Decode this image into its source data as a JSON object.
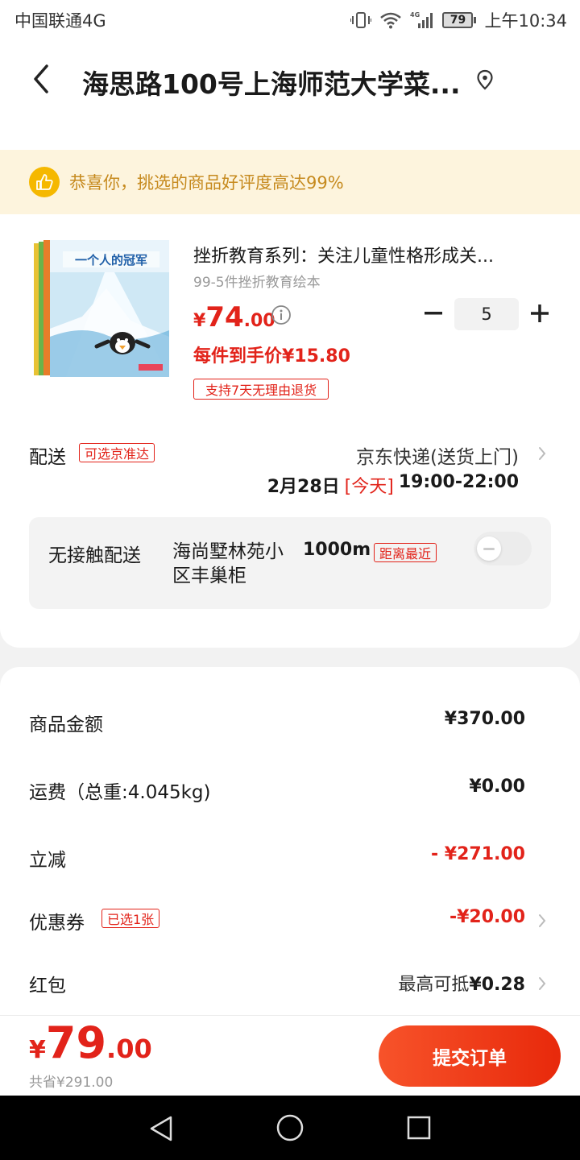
{
  "status_bar": {
    "carrier": "中国联通4G",
    "battery": "79",
    "time": "上午10:34",
    "network_label": "4G"
  },
  "header": {
    "address": "海思路100号上海师范大学菜..."
  },
  "banner": {
    "text": "恭喜你，挑选的商品好评度高达99%"
  },
  "product": {
    "title": "挫折教育系列：关注儿童性格形成关...",
    "subtitle": "99-5件挫折教育绘本",
    "price_currency": "¥",
    "price_int": "74",
    "price_dec": ".00",
    "quantity": "5",
    "unit_price": "每件到手价¥15.80",
    "return_policy": "支持7天无理由退货",
    "cover_title": "一个人的冠军"
  },
  "shipping": {
    "label": "配送",
    "tag": "可选京准达",
    "method": "京东快递(送货上门)",
    "date": "2月28日",
    "today": "[今天]",
    "window": "19:00-22:00"
  },
  "contactless": {
    "label": "无接触配送",
    "place": "海尚墅林苑小区丰巢柜",
    "distance": "1000m",
    "tag": "距离最近",
    "enabled": false
  },
  "summary": {
    "rows": [
      {
        "label": "商品金额",
        "value": "¥370.00"
      },
      {
        "label": "运费（总重:4.045kg)",
        "value": "¥0.00"
      },
      {
        "label": "立减",
        "value": "- ¥271.00"
      },
      {
        "label": "优惠券",
        "tag": "已选1张",
        "value": "-¥20.00"
      },
      {
        "label": "红包",
        "value_prefix": "最高可抵",
        "value": "¥0.28"
      }
    ]
  },
  "footer": {
    "total_currency": "¥",
    "total_int": "79",
    "total_dec": ".00",
    "saved": "共省¥291.00",
    "submit_label": "提交订单"
  },
  "colors": {
    "accent_red": "#e2231a",
    "banner_bg": "#fdf4dd",
    "banner_text": "#c68a1e",
    "submit_gradient_start": "#f7532a",
    "submit_gradient_end": "#e8290b"
  }
}
